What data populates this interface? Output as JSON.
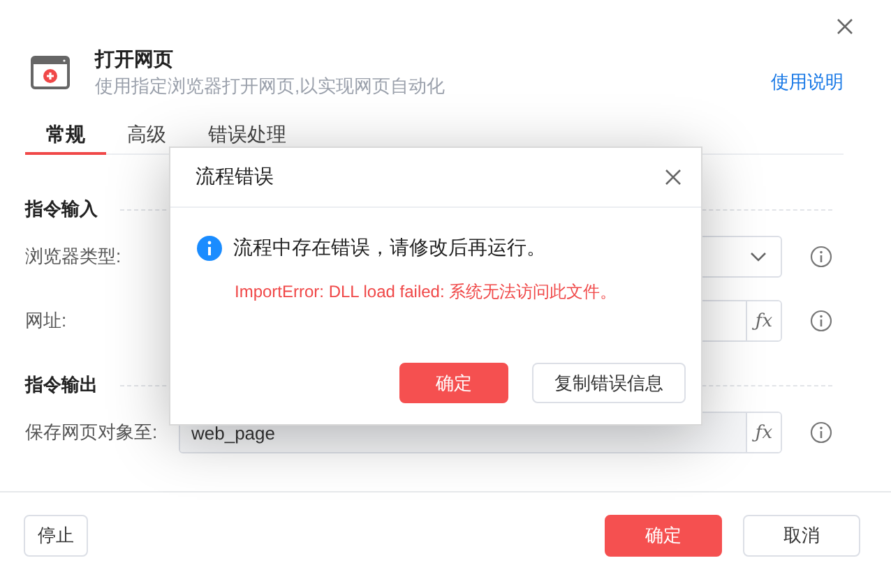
{
  "window": {
    "title": "打开网页",
    "subtitle": "使用指定浏览器打开网页,以实现网页自动化",
    "help_link": "使用说明"
  },
  "tabs": [
    {
      "label": "常规",
      "selected": true
    },
    {
      "label": "高级",
      "selected": false
    },
    {
      "label": "错误处理",
      "selected": false
    }
  ],
  "sections": [
    {
      "title": "指令输入",
      "fields": [
        {
          "label": "浏览器类型:",
          "kind": "select"
        },
        {
          "label": "网址:",
          "kind": "expression",
          "button": "ƒx"
        }
      ]
    },
    {
      "title": "指令输出",
      "fields": [
        {
          "label": "保存网页对象至:",
          "kind": "expression",
          "button": "ƒx",
          "value": "web_page"
        }
      ]
    }
  ],
  "footer": {
    "stop_button": "停止",
    "ok_button": "确定",
    "cancel_button": "取消"
  },
  "modal": {
    "title": "流程错误",
    "message": "流程中存在错误，请修改后再运行。",
    "error": "ImportError: DLL load failed: 系统无法访问此文件。",
    "buttons": [
      {
        "label": "确定",
        "kind": "primary"
      },
      {
        "label": "复制错误信息",
        "kind": "secondary"
      }
    ]
  }
}
